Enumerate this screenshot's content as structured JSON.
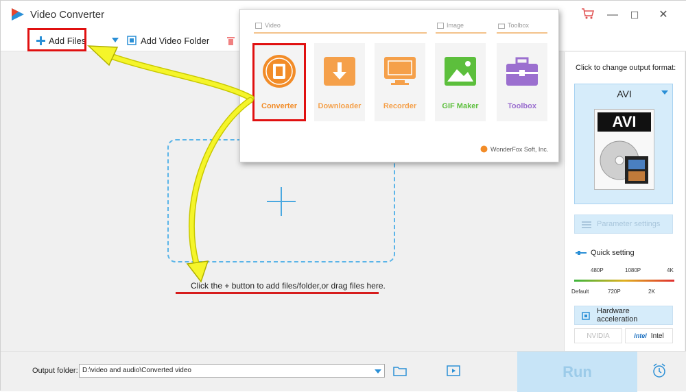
{
  "app": {
    "title": "Video Converter",
    "minimize": "—",
    "maximize": "☐",
    "close": "✕"
  },
  "toolbar": {
    "add_files": "Add Files",
    "add_folder": "Add Video Folder"
  },
  "main": {
    "hint": "Click the + button to add files/folder,or drag files here."
  },
  "popup": {
    "categories": {
      "video": "Video",
      "image": "Image",
      "toolbox": "Toolbox"
    },
    "tools": [
      {
        "label": "Converter",
        "color": "#f28c28"
      },
      {
        "label": "Downloader",
        "color": "#f5a04a"
      },
      {
        "label": "Recorder",
        "color": "#f5a04a"
      },
      {
        "label": "GIF Maker",
        "color": "#5cbf3c"
      },
      {
        "label": "Toolbox",
        "color": "#9b6fcf"
      }
    ],
    "brand": "WonderFox Soft, Inc."
  },
  "right_panel": {
    "change_format_label": "Click to change output format:",
    "format": "AVI",
    "format_image_text": "AVI",
    "parameter_settings": "Parameter settings",
    "quick_setting": "Quick setting",
    "slider_top": [
      "480P",
      "1080P",
      "4K"
    ],
    "slider_bottom": [
      "Default",
      "720P",
      "2K"
    ],
    "hardware_acceleration": "Hardware acceleration",
    "nvidia": "NVIDIA",
    "intel_logo": "intel",
    "intel": "Intel"
  },
  "bottom": {
    "output_folder_label": "Output folder:",
    "output_folder_value": "D:\\video and audio\\Converted video",
    "run": "Run"
  },
  "colors": {
    "accent": "#2a8fd6",
    "highlight": "#e01010",
    "arrow": "#f5f52a"
  }
}
